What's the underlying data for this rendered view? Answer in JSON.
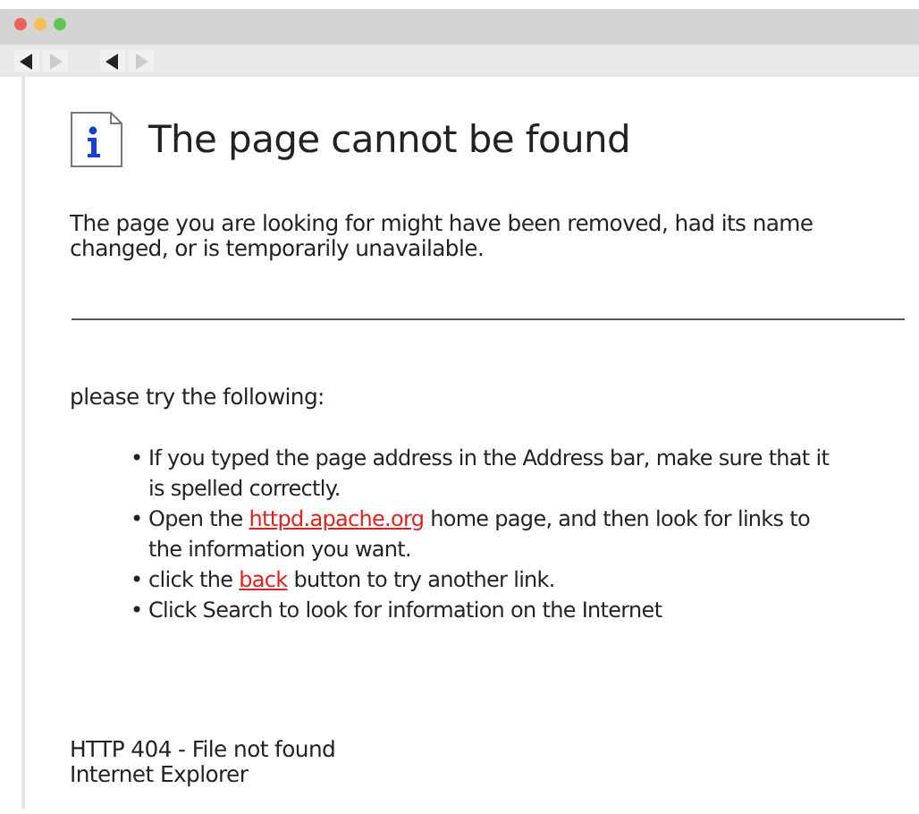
{
  "window_controls": [
    {
      "color": "#ee5f57"
    },
    {
      "color": "#f5c04a"
    },
    {
      "color": "#62c554"
    }
  ],
  "nav_buttons": [
    {
      "kind": "back",
      "disabled": false
    },
    {
      "kind": "forward",
      "disabled": true
    },
    {
      "kind": "back",
      "disabled": false
    },
    {
      "kind": "forward",
      "disabled": true
    }
  ],
  "heading": "The page cannot be found",
  "message": "The page you are looking for might have been removed, had its name changed, or is temporarily unavailable.",
  "suggestions_intro": "please try the following:",
  "suggestions": [
    {
      "bullet": "•",
      "segments": [
        {
          "kind": "text",
          "text": "If you typed the page address in the Address bar, make sure that it is spelled correctly."
        }
      ]
    },
    {
      "bullet": "•",
      "segments": [
        {
          "kind": "text",
          "text": "Open the "
        },
        {
          "kind": "link",
          "text": "httpd.apache.org"
        },
        {
          "kind": "text",
          "text": " home page, and then look for links to the information you want."
        }
      ]
    },
    {
      "bullet": "•",
      "segments": [
        {
          "kind": "text",
          "text": "click the "
        },
        {
          "kind": "link",
          "text": "back"
        },
        {
          "kind": "text",
          "text": " button to try another link."
        }
      ]
    },
    {
      "bullet": "•",
      "segments": [
        {
          "kind": "text",
          "text": "Click Search to look for information on the Internet"
        }
      ]
    }
  ],
  "footer": [
    "HTTP 404 - File not found",
    "Internet Explorer"
  ]
}
